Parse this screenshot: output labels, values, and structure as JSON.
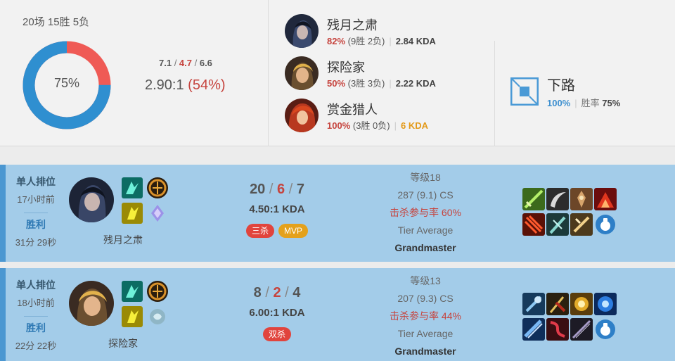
{
  "summary": {
    "record": "20场 15胜 5负",
    "winrate_label": "75%",
    "winrate": 0.75,
    "avg_kills": "7.1",
    "avg_deaths": "4.7",
    "avg_assists": "6.6",
    "kda_ratio": "2.90:1",
    "kill_participation": "(54%)",
    "colors": {
      "win": "#2f8fd0",
      "loss": "#ef5a55"
    }
  },
  "champions": [
    {
      "name": "残月之肃",
      "winrate": "82%",
      "record": "(9胜 2负)",
      "kda": "2.84 KDA",
      "kda_gold": false
    },
    {
      "name": "探险家",
      "winrate": "50%",
      "record": "(3胜 3负)",
      "kda": "2.22 KDA",
      "kda_gold": false
    },
    {
      "name": "赏金猎人",
      "winrate": "100%",
      "record": "(3胜 0负)",
      "kda": "6 KDA",
      "kda_gold": true
    }
  ],
  "lane": {
    "name": "下路",
    "share": "100%",
    "winrate_label": "胜率",
    "winrate": "75%"
  },
  "matches": [
    {
      "queue": "单人排位",
      "time_ago": "17小时前",
      "result": "胜利",
      "duration": "31分 29秒",
      "champion": "残月之肃",
      "kills": "20",
      "deaths": "6",
      "assists": "7",
      "kda_ratio": "4.50:1 KDA",
      "badges": [
        {
          "text": "三杀",
          "color": "red"
        },
        {
          "text": "MVP",
          "color": "gold"
        }
      ],
      "level": "等级18",
      "cs": "287 (9.1) CS",
      "kill_participation": "击杀参与率 60%",
      "tier_label": "Tier Average",
      "tier": "Grandmaster"
    },
    {
      "queue": "单人排位",
      "time_ago": "18小时前",
      "result": "胜利",
      "duration": "22分 22秒",
      "champion": "探险家",
      "kills": "8",
      "deaths": "2",
      "assists": "4",
      "kda_ratio": "6.00:1 KDA",
      "badges": [
        {
          "text": "双杀",
          "color": "red"
        }
      ],
      "level": "等级13",
      "cs": "207 (9.3) CS",
      "kill_participation": "击杀参与率 44%",
      "tier_label": "Tier Average",
      "tier": "Grandmaster"
    }
  ]
}
